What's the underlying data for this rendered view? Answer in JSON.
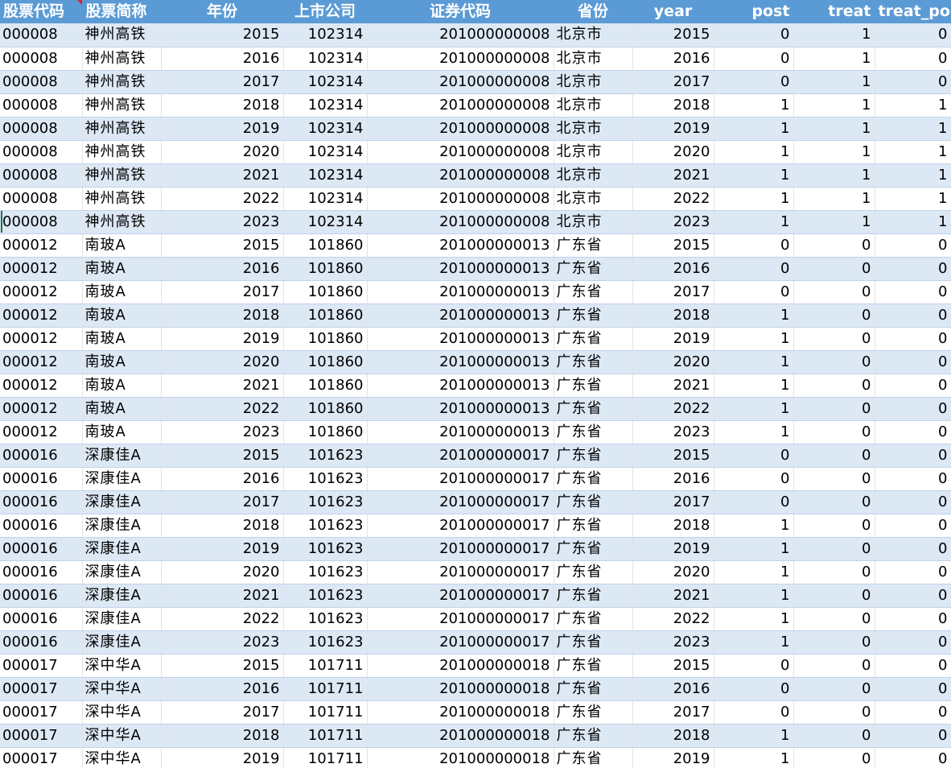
{
  "sheet": {
    "headers": [
      "股票代码",
      "股票简称",
      "年份",
      "上市公司",
      "证券代码",
      "省份",
      "year",
      "post",
      "treat",
      "treat_post"
    ],
    "rows": [
      [
        "000008",
        "神州高铁",
        "2015",
        "102314",
        "201000000008",
        "北京市",
        "2015",
        "0",
        "1",
        "0"
      ],
      [
        "000008",
        "神州高铁",
        "2016",
        "102314",
        "201000000008",
        "北京市",
        "2016",
        "0",
        "1",
        "0"
      ],
      [
        "000008",
        "神州高铁",
        "2017",
        "102314",
        "201000000008",
        "北京市",
        "2017",
        "0",
        "1",
        "0"
      ],
      [
        "000008",
        "神州高铁",
        "2018",
        "102314",
        "201000000008",
        "北京市",
        "2018",
        "1",
        "1",
        "1"
      ],
      [
        "000008",
        "神州高铁",
        "2019",
        "102314",
        "201000000008",
        "北京市",
        "2019",
        "1",
        "1",
        "1"
      ],
      [
        "000008",
        "神州高铁",
        "2020",
        "102314",
        "201000000008",
        "北京市",
        "2020",
        "1",
        "1",
        "1"
      ],
      [
        "000008",
        "神州高铁",
        "2021",
        "102314",
        "201000000008",
        "北京市",
        "2021",
        "1",
        "1",
        "1"
      ],
      [
        "000008",
        "神州高铁",
        "2022",
        "102314",
        "201000000008",
        "北京市",
        "2022",
        "1",
        "1",
        "1"
      ],
      [
        "000008",
        "神州高铁",
        "2023",
        "102314",
        "201000000008",
        "北京市",
        "2023",
        "1",
        "1",
        "1"
      ],
      [
        "000012",
        "南玻A",
        "2015",
        "101860",
        "201000000013",
        "广东省",
        "2015",
        "0",
        "0",
        "0"
      ],
      [
        "000012",
        "南玻A",
        "2016",
        "101860",
        "201000000013",
        "广东省",
        "2016",
        "0",
        "0",
        "0"
      ],
      [
        "000012",
        "南玻A",
        "2017",
        "101860",
        "201000000013",
        "广东省",
        "2017",
        "0",
        "0",
        "0"
      ],
      [
        "000012",
        "南玻A",
        "2018",
        "101860",
        "201000000013",
        "广东省",
        "2018",
        "1",
        "0",
        "0"
      ],
      [
        "000012",
        "南玻A",
        "2019",
        "101860",
        "201000000013",
        "广东省",
        "2019",
        "1",
        "0",
        "0"
      ],
      [
        "000012",
        "南玻A",
        "2020",
        "101860",
        "201000000013",
        "广东省",
        "2020",
        "1",
        "0",
        "0"
      ],
      [
        "000012",
        "南玻A",
        "2021",
        "101860",
        "201000000013",
        "广东省",
        "2021",
        "1",
        "0",
        "0"
      ],
      [
        "000012",
        "南玻A",
        "2022",
        "101860",
        "201000000013",
        "广东省",
        "2022",
        "1",
        "0",
        "0"
      ],
      [
        "000012",
        "南玻A",
        "2023",
        "101860",
        "201000000013",
        "广东省",
        "2023",
        "1",
        "0",
        "0"
      ],
      [
        "000016",
        "深康佳A",
        "2015",
        "101623",
        "201000000017",
        "广东省",
        "2015",
        "0",
        "0",
        "0"
      ],
      [
        "000016",
        "深康佳A",
        "2016",
        "101623",
        "201000000017",
        "广东省",
        "2016",
        "0",
        "0",
        "0"
      ],
      [
        "000016",
        "深康佳A",
        "2017",
        "101623",
        "201000000017",
        "广东省",
        "2017",
        "0",
        "0",
        "0"
      ],
      [
        "000016",
        "深康佳A",
        "2018",
        "101623",
        "201000000017",
        "广东省",
        "2018",
        "1",
        "0",
        "0"
      ],
      [
        "000016",
        "深康佳A",
        "2019",
        "101623",
        "201000000017",
        "广东省",
        "2019",
        "1",
        "0",
        "0"
      ],
      [
        "000016",
        "深康佳A",
        "2020",
        "101623",
        "201000000017",
        "广东省",
        "2020",
        "1",
        "0",
        "0"
      ],
      [
        "000016",
        "深康佳A",
        "2021",
        "101623",
        "201000000017",
        "广东省",
        "2021",
        "1",
        "0",
        "0"
      ],
      [
        "000016",
        "深康佳A",
        "2022",
        "101623",
        "201000000017",
        "广东省",
        "2022",
        "1",
        "0",
        "0"
      ],
      [
        "000016",
        "深康佳A",
        "2023",
        "101623",
        "201000000017",
        "广东省",
        "2023",
        "1",
        "0",
        "0"
      ],
      [
        "000017",
        "深中华A",
        "2015",
        "101711",
        "201000000018",
        "广东省",
        "2015",
        "0",
        "0",
        "0"
      ],
      [
        "000017",
        "深中华A",
        "2016",
        "101711",
        "201000000018",
        "广东省",
        "2016",
        "0",
        "0",
        "0"
      ],
      [
        "000017",
        "深中华A",
        "2017",
        "101711",
        "201000000018",
        "广东省",
        "2017",
        "0",
        "0",
        "0"
      ],
      [
        "000017",
        "深中华A",
        "2018",
        "101711",
        "201000000018",
        "广东省",
        "2018",
        "1",
        "0",
        "0"
      ],
      [
        "000017",
        "深中华A",
        "2019",
        "101711",
        "201000000018",
        "广东省",
        "2019",
        "1",
        "0",
        "0"
      ]
    ]
  },
  "colors": {
    "header_bg": "#5b9bd5",
    "header_text": "#ffffff",
    "band_blue": "#dde8f5",
    "band_white": "#ffffff",
    "comment_marker": "#e02020",
    "active_cell": "#1e7145"
  }
}
